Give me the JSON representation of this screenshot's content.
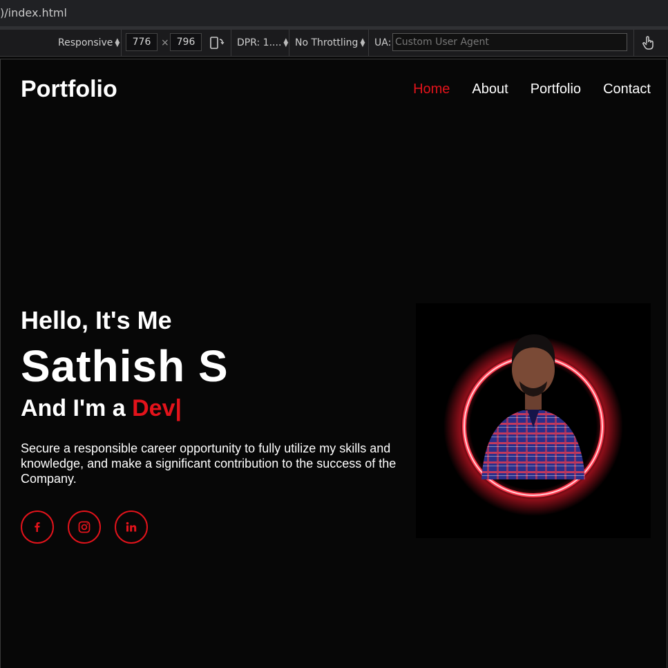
{
  "browser": {
    "url_fragment": ")/index.html"
  },
  "devtools": {
    "device_select": "Responsive",
    "width": "776",
    "times": "×",
    "height": "796",
    "dpr_label": "DPR: 1....",
    "throttling": "No Throttling",
    "ua_label": "UA:",
    "ua_placeholder": "Custom User Agent",
    "icons": [
      "rotate-icon",
      "touch-icon"
    ]
  },
  "header": {
    "logo": "Portfolio",
    "nav": [
      {
        "label": "Home",
        "active": true
      },
      {
        "label": "About",
        "active": false
      },
      {
        "label": "Portfolio",
        "active": false
      },
      {
        "label": "Contact",
        "active": false
      }
    ]
  },
  "hero": {
    "greeting": "Hello, It's Me",
    "name": "Sathish S",
    "role_prefix": "And I'm a",
    "role_typed": "Dev|",
    "description": "Secure a responsible career opportunity to fully utilize my skills and knowledge, and make a significant contribution to the success of the Company.",
    "socials": [
      "facebook-icon",
      "instagram-icon",
      "linkedin-icon"
    ]
  },
  "colors": {
    "accent": "#e3131b",
    "background": "#080808",
    "text": "#ffffff"
  }
}
